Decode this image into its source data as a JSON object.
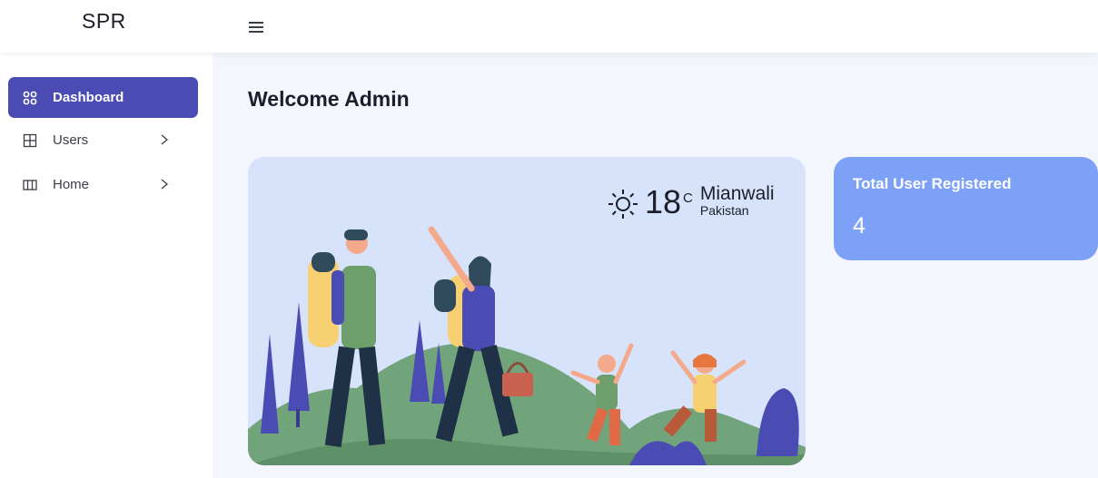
{
  "app": {
    "brand": "SPR"
  },
  "sidebar": {
    "items": [
      {
        "label": "Dashboard",
        "icon": "grid-four-icon",
        "active": true
      },
      {
        "label": "Users",
        "icon": "table-icon",
        "has_submenu": true
      },
      {
        "label": "Home",
        "icon": "columns-icon",
        "has_submenu": true
      }
    ]
  },
  "main": {
    "title": "Welcome Admin",
    "weather": {
      "temperature": "18",
      "unit": "C",
      "city": "Mianwali",
      "country": "Pakistan",
      "icon": "sun-icon"
    },
    "stat": {
      "label": "Total User Registered",
      "value": "4"
    }
  },
  "colors": {
    "accent": "#4a4bb3",
    "stat_card": "#7da1f7",
    "hero_bg": "#d6e3fb",
    "page_bg": "#f3f6fc"
  }
}
